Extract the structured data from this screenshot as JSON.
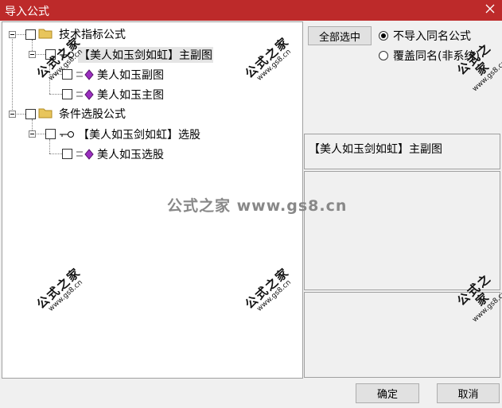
{
  "window": {
    "title": "导入公式"
  },
  "tree": {
    "tech_group": {
      "label": "技术指标公式",
      "child": {
        "label": "【美人如玉剑如虹】主副图",
        "items": [
          "美人如玉副图",
          "美人如玉主图"
        ]
      }
    },
    "condition_group": {
      "label": "条件选股公式",
      "child": {
        "label": "【美人如玉剑如虹】选股",
        "items": [
          "美人如玉选股"
        ]
      }
    }
  },
  "options": {
    "select_all_label": "全部选中",
    "radio_no_import": "不导入同名公式",
    "radio_overwrite": "覆盖同名(非系统)",
    "selected_radio": "no_import"
  },
  "info": {
    "selected_name": "【美人如玉剑如虹】主副图"
  },
  "buttons": {
    "ok": "确定",
    "cancel": "取消"
  },
  "watermark": {
    "text": "公式之家",
    "url": "www.gs8.cn",
    "center": "公式之家 www.gs8.cn"
  },
  "colors": {
    "titlebar": "#bd2a2a",
    "folder": "#e8c55c",
    "diamond": "#9b2fc0"
  }
}
